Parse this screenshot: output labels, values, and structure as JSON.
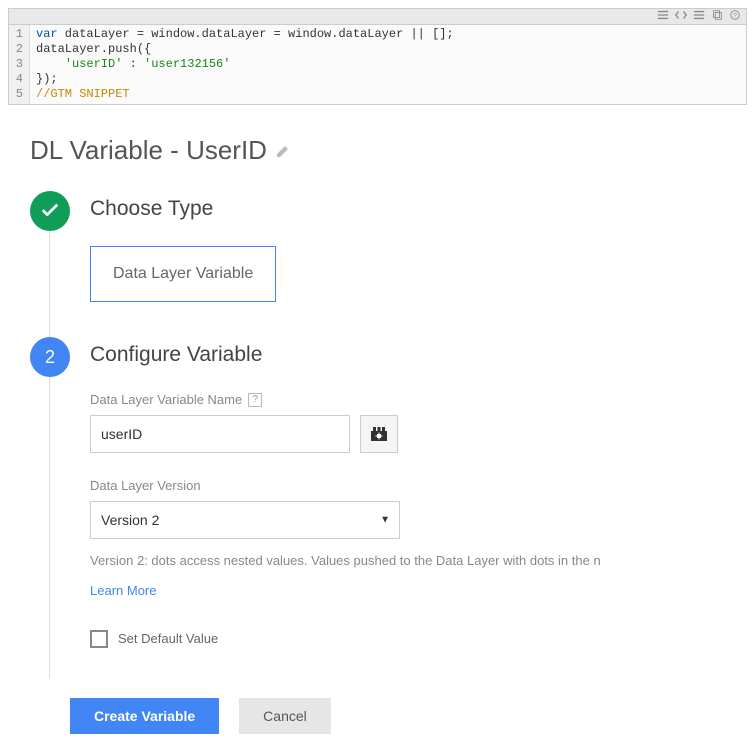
{
  "code": {
    "lines": [
      "1",
      "2",
      "3",
      "4",
      "5"
    ],
    "l1_kw": "var",
    "l1_rest": " dataLayer = window.dataLayer = window.dataLayer || [];",
    "l2": "dataLayer.push({",
    "l3_indent": "    ",
    "l3_key": "'userID'",
    "l3_sep": " : ",
    "l3_val": "'user132156'",
    "l4": "});",
    "l5": "//GTM SNIPPET"
  },
  "page": {
    "title": "DL Variable - UserID"
  },
  "step1": {
    "title": "Choose Type",
    "type_box": "Data Layer Variable"
  },
  "step2": {
    "badge": "2",
    "title": "Configure Variable",
    "var_name_label": "Data Layer Variable Name",
    "var_name_value": "userID",
    "help": "?",
    "version_label": "Data Layer Version",
    "version_value": "Version 2",
    "version_helper": "Version 2: dots access nested values. Values pushed to the Data Layer with dots in the n",
    "learn_more": "Learn More",
    "set_default": "Set Default Value"
  },
  "footer": {
    "create": "Create Variable",
    "cancel": "Cancel"
  }
}
